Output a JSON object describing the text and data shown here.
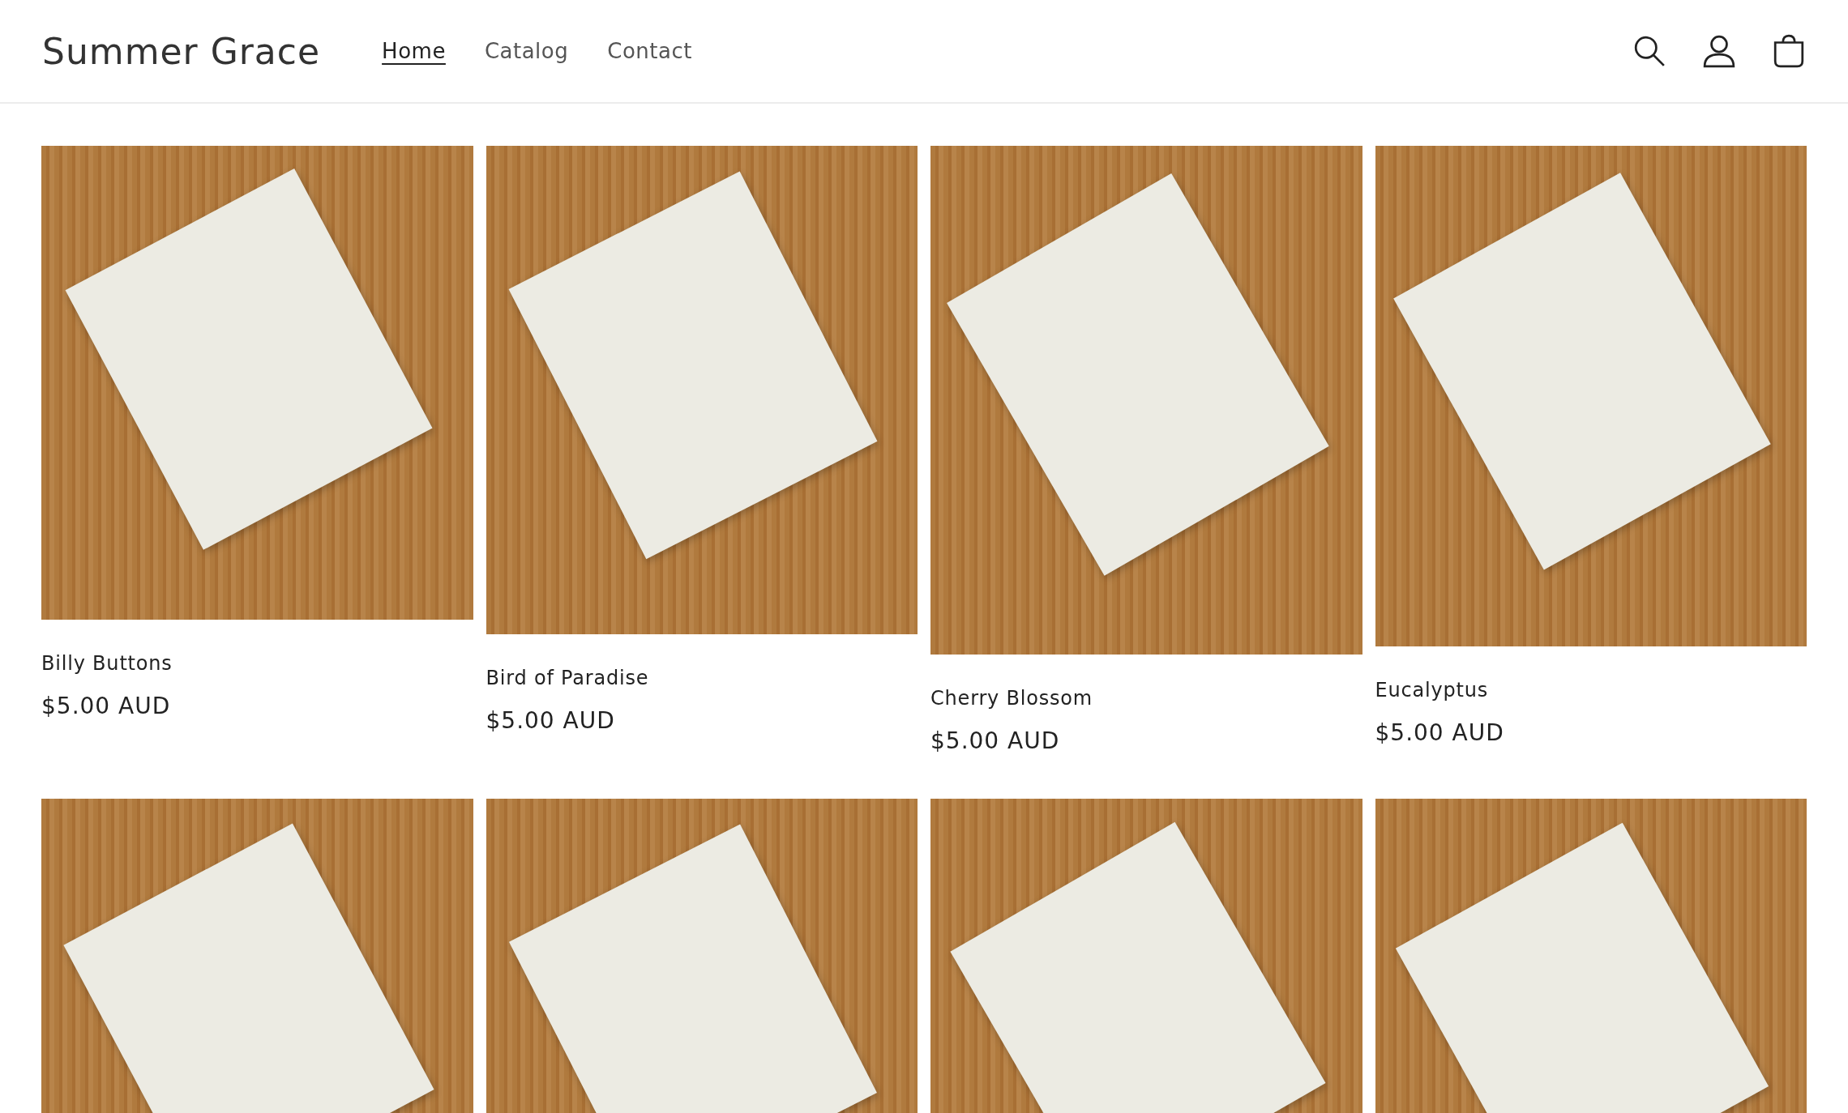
{
  "header": {
    "logo": "Summer Grace",
    "nav": [
      {
        "label": "Home",
        "selected": true
      },
      {
        "label": "Catalog",
        "selected": false
      },
      {
        "label": "Contact",
        "selected": false
      }
    ]
  },
  "products": [
    {
      "name": "Billy Buttons",
      "price": "$5.00 AUD"
    },
    {
      "name": "Bird of Paradise",
      "price": "$5.00 AUD"
    },
    {
      "name": "Cherry Blossom",
      "price": "$5.00 AUD"
    },
    {
      "name": "Eucalyptus",
      "price": "$5.00 AUD"
    }
  ]
}
